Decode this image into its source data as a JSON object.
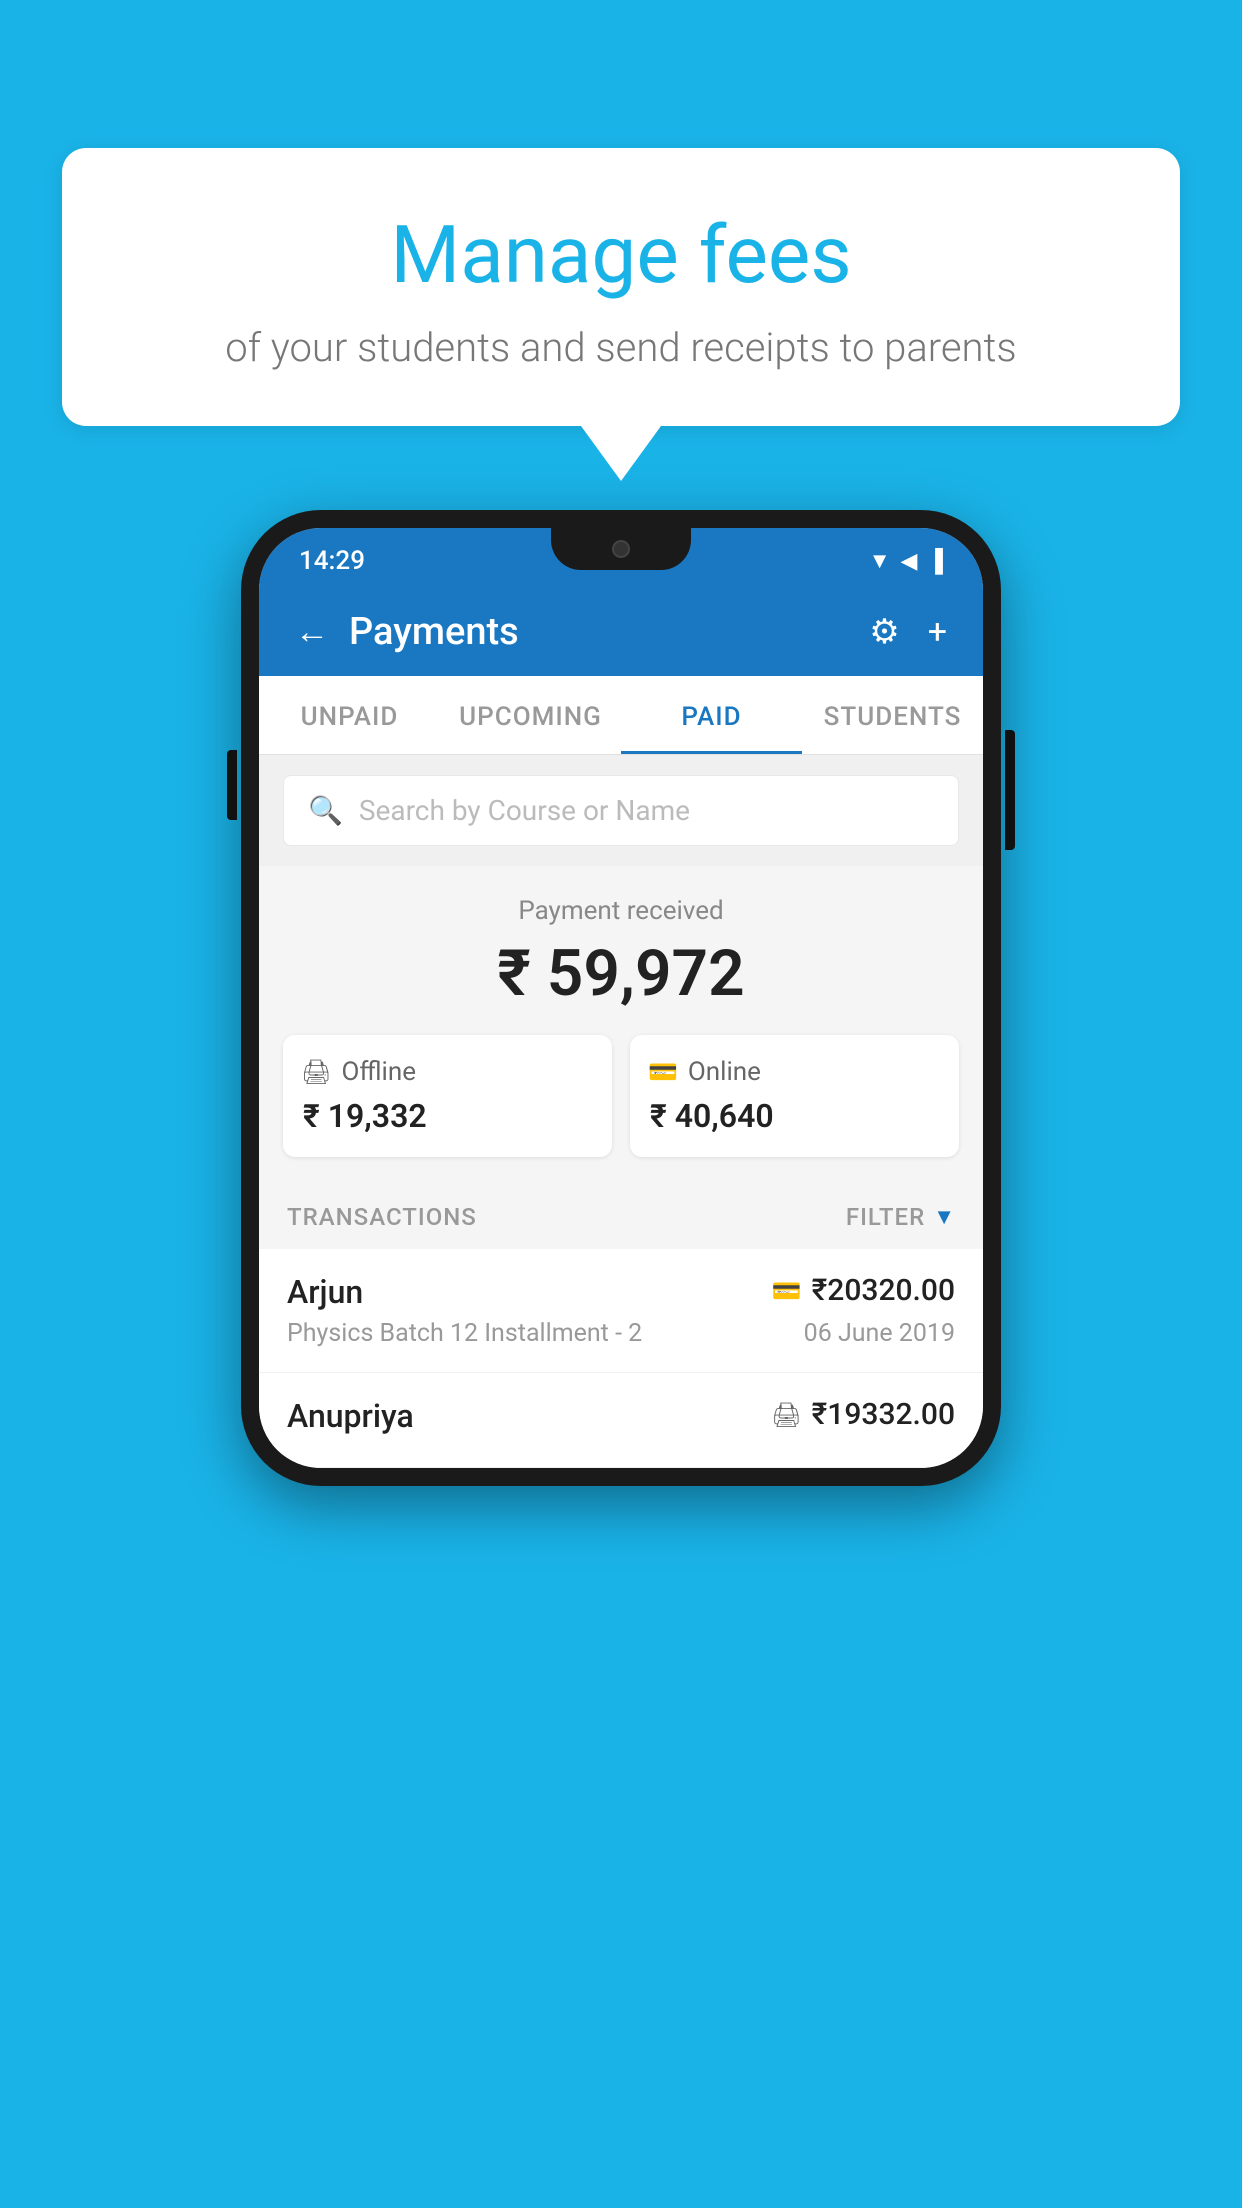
{
  "background_color": "#1ab3e8",
  "speech_bubble": {
    "title": "Manage fees",
    "subtitle": "of your students and send receipts to parents"
  },
  "phone": {
    "status_bar": {
      "time": "14:29",
      "icons": [
        "▼",
        "◀",
        "▐"
      ]
    },
    "header": {
      "back_label": "←",
      "title": "Payments",
      "gear_label": "⚙",
      "plus_label": "+"
    },
    "tabs": [
      {
        "label": "UNPAID",
        "active": false
      },
      {
        "label": "UPCOMING",
        "active": false
      },
      {
        "label": "PAID",
        "active": true
      },
      {
        "label": "STUDENTS",
        "active": false
      }
    ],
    "search": {
      "placeholder": "Search by Course or Name",
      "icon": "🔍"
    },
    "payment_summary": {
      "label": "Payment received",
      "amount": "₹ 59,972",
      "offline": {
        "label": "Offline",
        "amount": "₹ 19,332",
        "icon": "💳"
      },
      "online": {
        "label": "Online",
        "amount": "₹ 40,640",
        "icon": "💳"
      }
    },
    "transactions": {
      "header_label": "TRANSACTIONS",
      "filter_label": "FILTER",
      "rows": [
        {
          "name": "Arjun",
          "course": "Physics Batch 12 Installment - 2",
          "amount": "₹20320.00",
          "date": "06 June 2019",
          "type": "online"
        },
        {
          "name": "Anupriya",
          "course": "",
          "amount": "₹19332.00",
          "date": "",
          "type": "offline"
        }
      ]
    }
  }
}
